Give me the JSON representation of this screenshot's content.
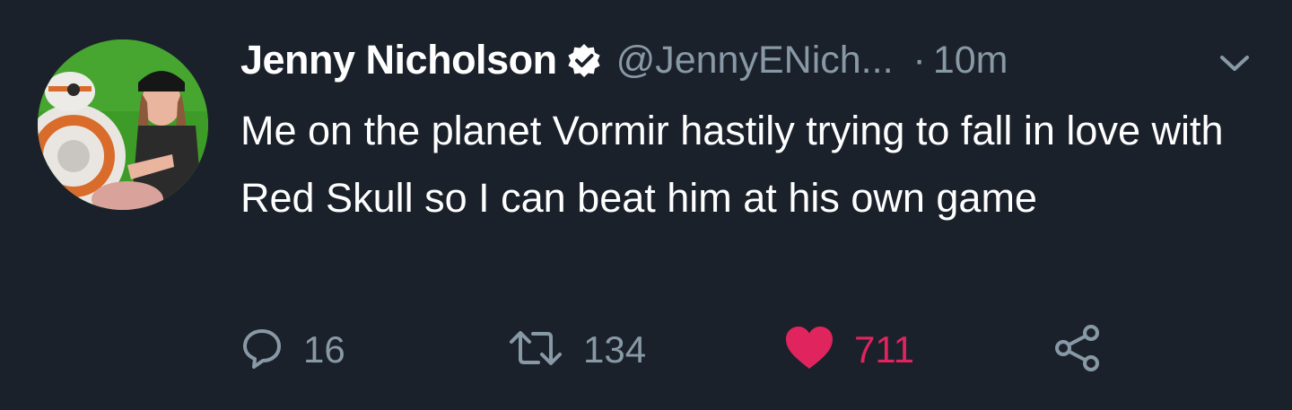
{
  "tweet": {
    "author": {
      "name": "Jenny Nicholson",
      "handle": "@JennyENich...",
      "verified": true
    },
    "separator": "·",
    "timestamp": "10m",
    "text": "Me on the planet Vormir hastily trying to fall in love with Red Skull so I can beat him at his own game",
    "actions": {
      "replies": "16",
      "retweets": "134",
      "likes": "711"
    }
  },
  "icons": {
    "verified": "verified-badge-icon",
    "caret": "chevron-down-icon",
    "reply": "speech-bubble-icon",
    "retweet": "retweet-arrows-icon",
    "like": "heart-icon",
    "share": "share-icon"
  },
  "colors": {
    "background": "#1b212b",
    "text": "#ffffff",
    "muted": "#8899a6",
    "like": "#e0245e"
  }
}
